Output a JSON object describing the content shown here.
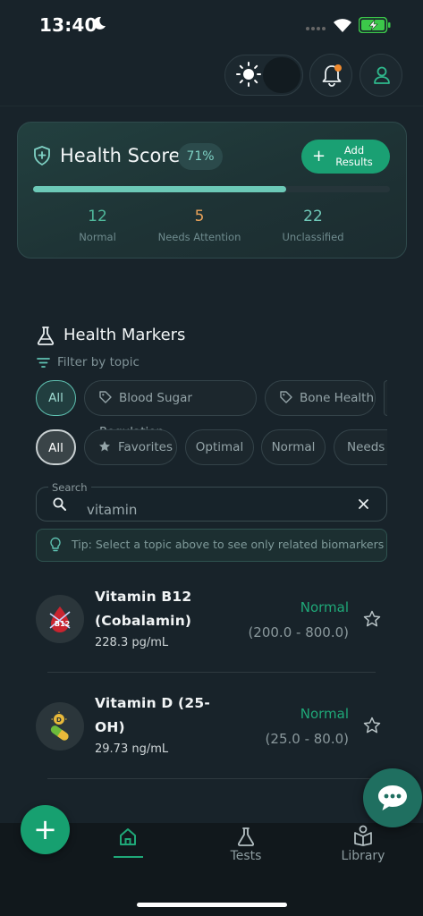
{
  "status_bar": {
    "time": "13:40"
  },
  "health_score": {
    "title": "Health Score",
    "percent_label": "71%",
    "progress": 0.71,
    "add_button_plus": "+",
    "add_button_label": "Add Results",
    "stats": [
      {
        "value": "12",
        "label": "Normal",
        "color": "#4fb79a"
      },
      {
        "value": "5",
        "label": "Needs Attention",
        "color": "#e8a25a"
      },
      {
        "value": "22",
        "label": "Unclassified",
        "color": "#6fc7b7"
      }
    ]
  },
  "markers": {
    "title": "Health Markers",
    "filter_label": "Filter by topic",
    "topic_chips": [
      "All",
      "Blood Sugar Regulation",
      "Bone Health"
    ],
    "status_chips": [
      "All",
      "Favorites",
      "Optimal",
      "Normal",
      "Needs A"
    ],
    "search": {
      "caption": "Search",
      "value": "vitamin"
    },
    "tip": "Tip: Select a topic above to see only related biomarkers",
    "items": [
      {
        "name_line1": "Vitamin B12",
        "name_line2": "(Cobalamin)",
        "value": "228.3 pg/mL",
        "status": "Normal",
        "range": "(200.0 - 800.0)",
        "icon": "b12-drop-icon"
      },
      {
        "name_line1": "Vitamin D (25-",
        "name_line2": "OH)",
        "value": "29.73 ng/mL",
        "status": "Normal",
        "range": "(25.0 - 80.0)",
        "icon": "vitamin-d-capsule-icon"
      }
    ]
  },
  "fab": {
    "label": "+"
  },
  "nav": {
    "items": [
      "",
      "Tests",
      "Library"
    ]
  },
  "colors": {
    "accent": "#1aa073",
    "background": "#18232a"
  }
}
